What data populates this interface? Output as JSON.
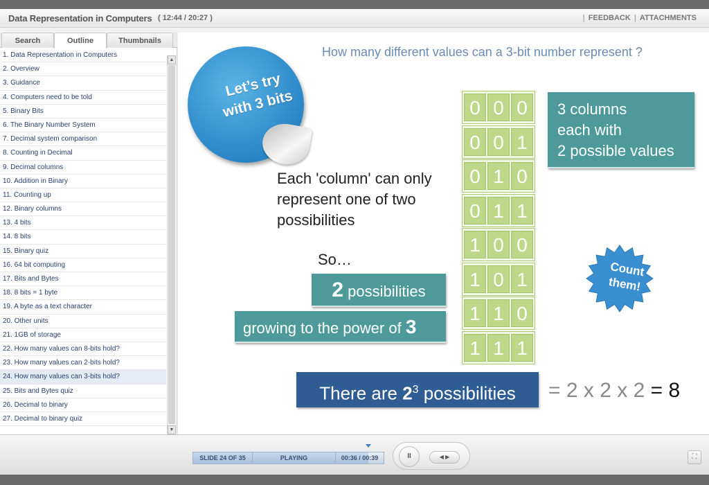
{
  "titlebar": {
    "title": "Data Representation in Computers",
    "time": "( 12:44 / 20:27 )",
    "feedback": "FEEDBACK",
    "attachments": "ATTACHMENTS"
  },
  "sidebar": {
    "tabs": [
      "Search",
      "Outline",
      "Thumbnails"
    ],
    "active_tab": "Outline",
    "items": [
      "1. Data Representation in Computers",
      "2. Overview",
      "3. Guidance",
      "4. Computers need to be told",
      "5. Binary Bits",
      "6. The Binary Number System",
      "7. Decimal system comparison",
      "8. Counting in Decimal",
      "9. Decimal columns",
      "10. Addition in Binary",
      "11. Counting up",
      "12. Binary columns",
      "13. 4 bits",
      "14. 8 bits",
      "15. Binary quiz",
      "16. 64 bit computing",
      "17. Bits and Bytes",
      "18. 8 bits = 1 byte",
      "19. A byte as a text character",
      "20. Other units",
      "21. 1GB of storage",
      "22. How many values can 8-bits hold?",
      "23. How many values can 2-bits hold?",
      "24. How many values can 3-bits hold?",
      "25. Bits and Bytes quiz",
      "26. Decimal to binary",
      "27. Decimal to binary quiz"
    ],
    "selected_index": 23
  },
  "slide": {
    "question": "How many different values can a 3-bit number represent ?",
    "badge_line1": "Let’s try",
    "badge_line2": "with 3 bits",
    "column_text": "Each 'column' can only represent one of two possibilities",
    "so": "So…",
    "possibilities_number": "2",
    "possibilities_text": " possibilities",
    "growing_text": "growing to the power of ",
    "growing_number": "3",
    "columns_line1": "3 columns",
    "columns_line2": "each with",
    "columns_line3": "2 possible values",
    "count_line1": "Count",
    "count_line2": "them!",
    "total_prefix": "There are ",
    "total_base": "2",
    "total_exp": "3",
    "total_suffix": " possibilities",
    "equation": "= 2 x 2 x 2 ",
    "equation_result": "= 8",
    "bits": [
      [
        "0",
        "0",
        "0"
      ],
      [
        "0",
        "0",
        "1"
      ],
      [
        "0",
        "1",
        "0"
      ],
      [
        "0",
        "1",
        "1"
      ],
      [
        "1",
        "0",
        "0"
      ],
      [
        "1",
        "0",
        "1"
      ],
      [
        "1",
        "1",
        "0"
      ],
      [
        "1",
        "1",
        "1"
      ]
    ]
  },
  "player": {
    "slide_label": "SLIDE 24 OF 35",
    "status": "PLAYING",
    "time": "00:36 / 00:39",
    "progress": 0.92,
    "pause_icon": "pause-icon",
    "seek_label": "◀ ▶"
  }
}
